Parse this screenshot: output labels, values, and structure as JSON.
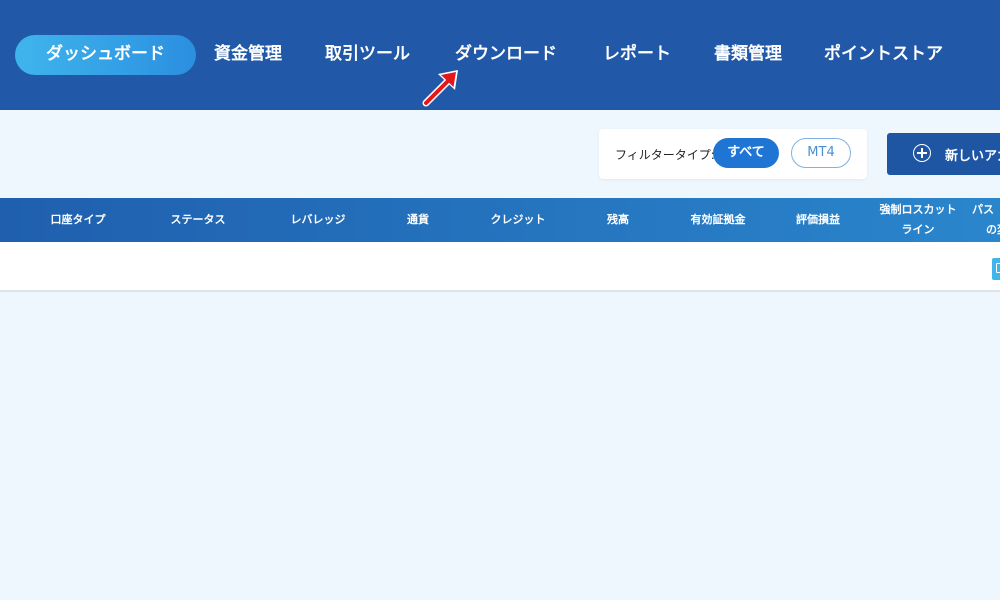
{
  "nav": {
    "active": "ダッシュボード",
    "items": [
      "資金管理",
      "取引ツール",
      "ダウンロード",
      "レポート",
      "書類管理",
      "ポイントストア"
    ]
  },
  "filter": {
    "label": "フィルタータイプ:",
    "options": [
      "すべて",
      "MT4"
    ],
    "selected": "すべて"
  },
  "new_account": {
    "label": "新しいアカ"
  },
  "table": {
    "columns": [
      "口座タイプ",
      "ステータス",
      "レバレッジ",
      "通貨",
      "クレジット",
      "残高",
      "有効証拠金",
      "評価損益",
      "強制ロスカット",
      "ライン",
      "パス",
      "の変"
    ]
  },
  "colors": {
    "nav_bg": "#2159a8",
    "active_pill": "#3fb5ec",
    "page_bg": "#eff7fe",
    "filter_selected": "#1f75d4",
    "button_bg": "#1f56a3",
    "annotation_arrow": "#e3161b"
  },
  "icons": {
    "plus": "plus-circle-icon",
    "row_action": "copy-icon",
    "annotation": "red-arrow-icon"
  }
}
